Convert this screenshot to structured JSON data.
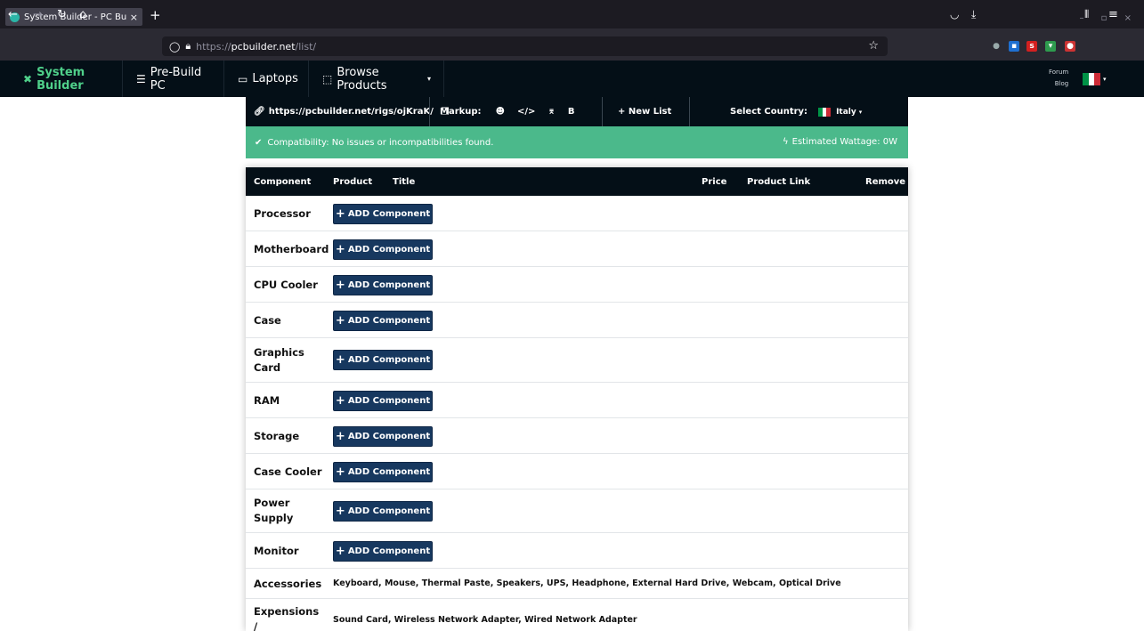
{
  "browser": {
    "tab_title": "System Builder - PC Build",
    "tab_close": "×",
    "new_tab": "+",
    "window_controls": "– ▫ ×",
    "url_protocol": "https://",
    "url_host": "pcbuilder.net",
    "url_path": "/list/"
  },
  "site_nav": {
    "items": [
      {
        "label": "System Builder",
        "icon": "tools-icon"
      },
      {
        "label": "Pre-Build PC",
        "icon": "server-icon"
      },
      {
        "label": "Laptops",
        "icon": "laptop-icon"
      },
      {
        "label": "Browse Products",
        "icon": "products-icon",
        "caret": "▾"
      }
    ],
    "forum": "Forum",
    "blog": "Blog"
  },
  "toolbar": {
    "share_link": "https://pcbuilder.net/rigs/ojKraK/",
    "markup_label": "Markup:",
    "markup_b": "B",
    "new_list": "+ New List",
    "select_country": "Select Country:",
    "country": "Italy",
    "country_caret": "▾"
  },
  "compat": {
    "message": "Compatibility: No issues or incompatibilities found.",
    "wattage": "Estimated Wattage: 0W"
  },
  "table": {
    "headers": {
      "component": "Component",
      "product": "Product",
      "title": "Title",
      "price": "Price",
      "link": "Product Link",
      "remove": "Remove"
    },
    "add_label": "ADD Component",
    "rows": [
      {
        "component": "Processor"
      },
      {
        "component": "Motherboard"
      },
      {
        "component": "CPU Cooler"
      },
      {
        "component": "Case"
      },
      {
        "component": "Graphics Card"
      },
      {
        "component": "RAM"
      },
      {
        "component": "Storage"
      },
      {
        "component": "Case Cooler"
      },
      {
        "component": "Power Supply"
      },
      {
        "component": "Monitor"
      },
      {
        "component": "Accessories",
        "links": "Keyboard, Mouse, Thermal Paste, Speakers, UPS, Headphone, External Hard Drive, Webcam, Optical Drive"
      },
      {
        "component": "Expensions / Networking",
        "links": "Sound Card, Wireless Network Adapter, Wired Network Adapter"
      }
    ]
  },
  "colors": {
    "nav_bg": "#040f17",
    "accent_green": "#4fd08a",
    "compat_bg": "#4bb98b",
    "button_blue": "#17385f",
    "flag": [
      "#009246",
      "#ffffff",
      "#ce2b37"
    ]
  }
}
